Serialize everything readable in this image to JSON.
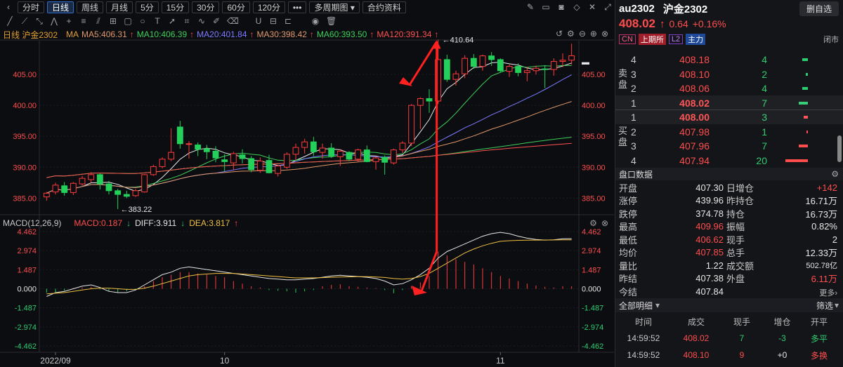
{
  "toolbar": {
    "periods": [
      "分时",
      "日线",
      "周线",
      "月线",
      "5分",
      "15分",
      "30分",
      "60分",
      "120分"
    ],
    "active_period": "日线",
    "more_label": "•••",
    "multi_label": "多周期图",
    "contract_label": "合约资料"
  },
  "legend": {
    "name": "日线 沪金2302",
    "ma": "MA",
    "ma5": "MA5:406.31",
    "ma10": "MA10:406.39",
    "ma20": "MA20:401.84",
    "ma30": "MA30:398.42",
    "ma60": "MA60:393.50",
    "ma120": "MA120:391.34"
  },
  "macd_legend": {
    "title": "MACD(12,26,9)",
    "macd": "MACD:0.187",
    "diff": "DIFF:3.911",
    "dea": "DEA:3.817"
  },
  "colors": {
    "ma5": "#e8e8e8",
    "ma10": "#f0c040",
    "ma20": "#7b7bff",
    "ma30": "#e0976a",
    "ma60": "#3ecf5a",
    "ma120": "#ff5050",
    "up": "#ff3b3b",
    "down": "#22d05a",
    "arrow": "#ff2020"
  },
  "chart_data": {
    "type": "candlestick",
    "price_ticks": [
      "405.00",
      "400.00",
      "395.00",
      "390.00",
      "385.00"
    ],
    "macd_ticks": [
      "4.462",
      "2.974",
      "1.487",
      "0.000",
      "-1.487",
      "-2.974",
      "-4.462"
    ],
    "x_labels": [
      "2022/09",
      "10",
      "11"
    ],
    "annotation_high": "←410.64",
    "annotation_low": "←383.22",
    "ylim": [
      383,
      410
    ],
    "candles": [
      [
        385.2,
        386,
        384.6,
        385.8
      ],
      [
        386,
        387.5,
        385.6,
        387.1
      ],
      [
        387,
        387.6,
        385.4,
        385.9
      ],
      [
        385.9,
        387.6,
        385.5,
        387.4
      ],
      [
        387.3,
        388.6,
        387,
        388.2
      ],
      [
        388,
        389.2,
        387.5,
        388.8
      ],
      [
        388.8,
        389,
        386.4,
        387.3
      ],
      [
        387.3,
        387.8,
        385.6,
        386.2
      ],
      [
        386.2,
        386.5,
        383.22,
        385.6
      ],
      [
        385.6,
        386.2,
        385,
        385.3
      ],
      [
        385.4,
        386.5,
        385.2,
        386.2
      ],
      [
        386,
        388.9,
        385.9,
        388.8
      ],
      [
        388.8,
        390.4,
        388.6,
        390.1
      ],
      [
        390.1,
        391.6,
        389.8,
        391.3
      ],
      [
        391.3,
        396.3,
        391,
        392.4
      ],
      [
        396.5,
        397.5,
        393,
        393.8
      ],
      [
        393.8,
        394.2,
        391.4,
        393.8
      ],
      [
        393.6,
        394,
        391.8,
        392.9
      ],
      [
        393,
        393.6,
        391.3,
        392.5
      ],
      [
        392.6,
        393.4,
        390.8,
        391.5
      ],
      [
        391.2,
        392.1,
        389.3,
        390.9
      ],
      [
        390.7,
        392.5,
        389.5,
        392.2
      ],
      [
        392,
        392.9,
        390.6,
        391.4
      ],
      [
        391.4,
        391.8,
        389.2,
        389.6
      ],
      [
        389.5,
        391.6,
        389.1,
        391
      ],
      [
        391.1,
        392,
        389,
        389.1
      ],
      [
        389,
        390.4,
        388.5,
        390.2
      ],
      [
        390,
        392.4,
        389.7,
        392.1
      ],
      [
        392.1,
        393.8,
        391.2,
        393.2
      ],
      [
        393.2,
        394.6,
        392.2,
        394.1
      ],
      [
        394.1,
        394.9,
        391.8,
        392.5
      ],
      [
        392.4,
        393.8,
        391.4,
        393.1
      ],
      [
        393.1,
        393.9,
        391.5,
        391.8
      ],
      [
        391.7,
        392.9,
        390.2,
        392.6
      ],
      [
        392.4,
        392.6,
        391,
        391.3
      ],
      [
        391.3,
        393,
        390.8,
        392.8
      ],
      [
        392.8,
        393.5,
        390.8,
        390.9
      ],
      [
        390.9,
        391.8,
        389.6,
        391.5
      ],
      [
        391.6,
        391.9,
        388.8,
        390.8
      ],
      [
        390.7,
        393,
        390.4,
        392.8
      ],
      [
        392.8,
        394.2,
        392.3,
        393.9
      ],
      [
        393.9,
        400.2,
        393.4,
        400
      ],
      [
        400,
        401.3,
        396.2,
        401.1
      ],
      [
        401.1,
        402.6,
        398.8,
        400.7
      ],
      [
        400.7,
        410.64,
        400.2,
        407.4
      ],
      [
        407.4,
        408.2,
        403.8,
        404.2
      ],
      [
        404.2,
        405.6,
        403.2,
        405.1
      ],
      [
        405.1,
        408.1,
        404.4,
        407.6
      ],
      [
        407.6,
        408.3,
        405.9,
        406.3
      ],
      [
        406.3,
        408.2,
        405.6,
        408
      ],
      [
        408,
        408.6,
        406.4,
        407.4
      ],
      [
        407.4,
        407.6,
        405.3,
        405.6
      ],
      [
        405.5,
        406.6,
        404.6,
        406.3
      ],
      [
        406.3,
        406.8,
        404.7,
        405.3
      ],
      [
        405.3,
        406.2,
        403.9,
        405.6
      ],
      [
        405.6,
        406.4,
        405,
        406
      ],
      [
        405.9,
        406.5,
        402.8,
        405.8
      ],
      [
        405.8,
        407.6,
        404.8,
        407.1
      ],
      [
        407.1,
        408.4,
        406.2,
        407.3
      ],
      [
        407.3,
        409.96,
        406.62,
        408.02
      ]
    ],
    "macd_hist": [
      -0.3,
      -0.25,
      -0.15,
      0.05,
      0.1,
      0.15,
      -0.05,
      -0.2,
      -0.3,
      -0.2,
      -0.1,
      0.2,
      0.6,
      0.9,
      1.1,
      1.3,
      1.3,
      1.2,
      1.1,
      1.0,
      0.9,
      0.6,
      0.4,
      0.2,
      0.1,
      -0.1,
      -0.15,
      -0.2,
      -0.3,
      -0.2,
      -0.1,
      0.2,
      0.3,
      0.35,
      0.2,
      0.15,
      0.1,
      0.05,
      -0.1,
      -0.35,
      -0.1,
      0.2,
      0.5,
      1.0,
      2.9,
      2.6,
      2.3,
      2.1,
      1.9,
      1.6,
      1.3,
      1.0,
      0.8,
      0.6,
      0.4,
      0.25,
      0.15,
      0.1,
      0.2,
      0.19
    ],
    "macd_diff": [
      -0.6,
      -0.3,
      -0.2,
      0,
      0.2,
      0.3,
      0.1,
      -0.2,
      -0.3,
      -0.3,
      -0.1,
      0.3,
      0.7,
      1.1,
      1.3,
      1.6,
      1.7,
      1.6,
      1.5,
      1.4,
      1.3,
      1.2,
      1.1,
      1.0,
      0.9,
      0.8,
      0.75,
      0.7,
      0.7,
      0.75,
      0.8,
      0.9,
      1.0,
      1.05,
      1.0,
      0.95,
      0.9,
      0.8,
      0.6,
      0.3,
      0.4,
      0.7,
      1.1,
      1.6,
      2.4,
      2.9,
      3.2,
      3.5,
      3.8,
      4.1,
      4.3,
      4.4,
      4.3,
      4.1,
      3.95,
      3.85,
      3.8,
      3.82,
      3.9,
      3.911
    ],
    "macd_dea": [
      -0.4,
      -0.35,
      -0.3,
      -0.2,
      -0.1,
      0,
      0.05,
      0.05,
      0,
      -0.05,
      -0.05,
      0.05,
      0.2,
      0.4,
      0.6,
      0.8,
      1.0,
      1.1,
      1.15,
      1.2,
      1.2,
      1.2,
      1.15,
      1.1,
      1.05,
      1.0,
      0.95,
      0.9,
      0.85,
      0.85,
      0.85,
      0.87,
      0.9,
      0.92,
      0.93,
      0.94,
      0.94,
      0.92,
      0.88,
      0.8,
      0.75,
      0.8,
      0.95,
      1.2,
      1.6,
      2.0,
      2.4,
      2.8,
      3.1,
      3.35,
      3.55,
      3.7,
      3.75,
      3.78,
      3.79,
      3.8,
      3.8,
      3.81,
      3.815,
      3.817
    ]
  },
  "quote": {
    "code": "au2302",
    "name": "沪金2302",
    "delete_label": "删自选",
    "price": "408.02",
    "arrow": "↑",
    "change": "0.64",
    "pct": "+0.16%",
    "tags": [
      "CN",
      "上期所",
      "L2",
      "主力"
    ],
    "status": "闭市",
    "sell_label": "卖盘",
    "buy_label": "买盘"
  },
  "orderbook": {
    "asks": [
      [
        "4",
        "408.18",
        "4",
        8
      ],
      [
        "3",
        "408.10",
        "2",
        3
      ],
      [
        "2",
        "408.06",
        "4",
        8
      ],
      [
        "1",
        "408.02",
        "7",
        13
      ]
    ],
    "bids": [
      [
        "1",
        "408.00",
        "3",
        6
      ],
      [
        "2",
        "407.98",
        "1",
        2
      ],
      [
        "3",
        "407.96",
        "7",
        13
      ],
      [
        "4",
        "407.94",
        "20",
        32
      ]
    ]
  },
  "panel_title": "盘口数据",
  "stats": [
    [
      [
        "开盘",
        "407.30",
        "white"
      ],
      [
        "日增仓",
        "+142",
        "red"
      ]
    ],
    [
      [
        "涨停",
        "439.96",
        "white"
      ],
      [
        "昨持仓",
        "16.71万",
        "white"
      ]
    ],
    [
      [
        "跌停",
        "374.78",
        "white"
      ],
      [
        "持仓",
        "16.73万",
        "white"
      ]
    ],
    [
      [
        "最高",
        "409.96",
        "red"
      ],
      [
        "振幅",
        "0.82%",
        "white"
      ]
    ],
    [
      [
        "最低",
        "406.62",
        "red"
      ],
      [
        "现手",
        "2",
        "white"
      ]
    ],
    [
      [
        "均价",
        "407.85",
        "red"
      ],
      [
        "总手",
        "12.33万",
        "white"
      ]
    ],
    [
      [
        "量比",
        "1.22",
        "white"
      ],
      [
        "成交额",
        "502.78亿",
        "white"
      ]
    ],
    [
      [
        "昨结",
        "407.38",
        "white"
      ],
      [
        "外盘",
        "6.11万",
        "red"
      ]
    ],
    [
      [
        "今结",
        "407.84",
        "white"
      ],
      [
        "",
        "",
        " "
      ]
    ]
  ],
  "more_label": "更多›",
  "ticks_header": {
    "title": "全部明细",
    "filter": "筛选",
    "cols": [
      "时间",
      "成交",
      "现手",
      "增仓",
      "开平"
    ]
  },
  "ticks": [
    [
      "14:59:52",
      "408.02",
      "7",
      "-3",
      "多平"
    ],
    [
      "14:59:52",
      "408.10",
      "9",
      "+0",
      "多换"
    ]
  ]
}
